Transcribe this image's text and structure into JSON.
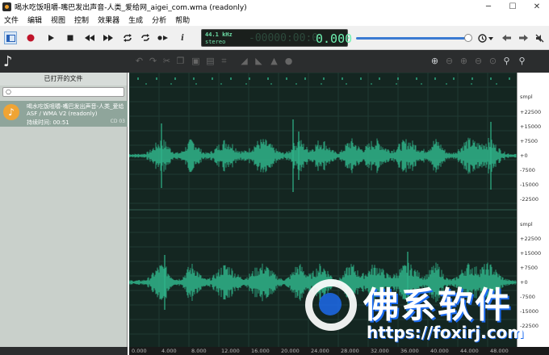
{
  "window": {
    "title": "喝水吃饭咀嚼-嘴巴发出声音-人类_爱给网_aigei_com.wma (readonly)",
    "minimize": "─",
    "maximize": "☐",
    "close": "✕"
  },
  "menu": [
    "文件",
    "编辑",
    "视图",
    "控制",
    "效果器",
    "生成",
    "分析",
    "帮助"
  ],
  "toolbar": {
    "sample_rate": "44.1 kHz",
    "channels": "stereo",
    "position_dim": "-00000:00:0",
    "position": "0.000",
    "icons": [
      "sidebar-icon",
      "record-icon",
      "play-icon",
      "stop-icon",
      "rewind-icon",
      "fast-forward-icon",
      "loop-icon",
      "loop-selection-icon",
      "play-cursor-icon",
      "info-icon"
    ]
  },
  "left_pane": {
    "title": "已打开的文件",
    "search_placeholder": "",
    "file": {
      "name": "喝水吃饭咀嚼-嘴巴发出声音-人类_爱给...",
      "format": "ASF / WMA V2 (readonly)",
      "duration": "持续时间: 00:51",
      "tag": "CD 03"
    }
  },
  "scale": {
    "top": {
      "unit": "smpl",
      "labels": [
        "+22500",
        "+15000",
        "+7500",
        "+0",
        "-7500",
        "-15000",
        "-22500"
      ]
    },
    "bottom": {
      "unit": "smpl",
      "labels": [
        "+22500",
        "+15000",
        "+7500",
        "+0",
        "-7500",
        "-15000",
        "-22500"
      ]
    }
  },
  "timeline": [
    "0.000",
    "4.000",
    "8.000",
    "12.000",
    "16.000",
    "20.000",
    "24.000",
    "28.000",
    "32.000",
    "36.000",
    "40.000",
    "44.000",
    "48.000"
  ],
  "watermark": {
    "name": "佛系软件",
    "url": "https://foxirj.com"
  },
  "colors": {
    "wave": "#2fb58a",
    "background": "#142621",
    "accent": "#3a7ad2"
  }
}
